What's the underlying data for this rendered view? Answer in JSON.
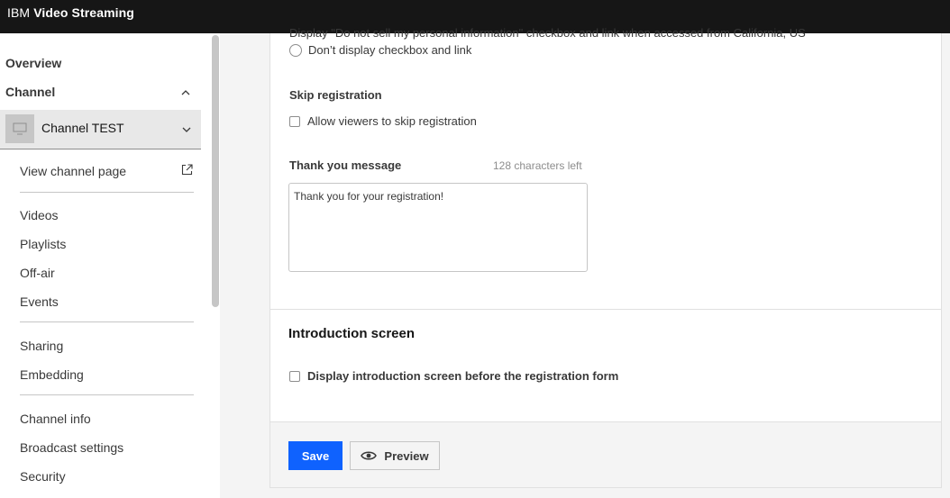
{
  "topbar": {
    "brand_prefix": "IBM",
    "brand_name": "Video Streaming"
  },
  "sidebar": {
    "overview": "Overview",
    "channel": "Channel",
    "channel_name": "Channel TEST",
    "view_channel_page": "View channel page",
    "group1": [
      "Videos",
      "Playlists",
      "Off-air",
      "Events"
    ],
    "group2": [
      "Sharing",
      "Embedding"
    ],
    "group3": [
      "Channel info",
      "Broadcast settings",
      "Security"
    ]
  },
  "form": {
    "cut_option": "Display \"Do not sell my personal information\" checkbox and link when accessed from California, US",
    "dont_display_option": "Don’t display checkbox and link",
    "skip_registration_label": "Skip registration",
    "skip_registration_check": "Allow viewers to skip registration",
    "thank_you_label": "Thank you message",
    "chars_left": "128 characters left",
    "thank_you_value": "Thank you for your registration!",
    "intro_title": "Introduction screen",
    "intro_check": "Display introduction screen before the registration form"
  },
  "footer": {
    "save": "Save",
    "preview": "Preview"
  },
  "colors": {
    "primary": "#0f62fe",
    "topbar": "#161616"
  }
}
